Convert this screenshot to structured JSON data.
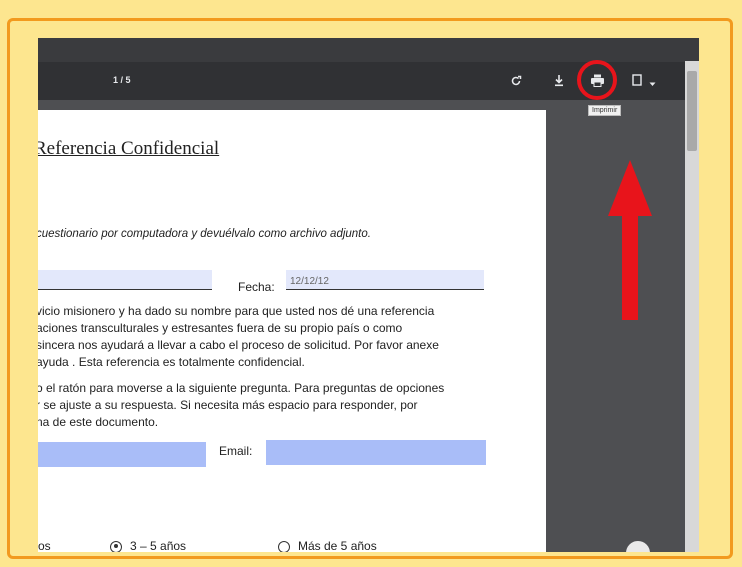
{
  "toolbar": {
    "page_count": "1 / 5",
    "tooltip": "Imprimir"
  },
  "icons": [
    "rotate-icon",
    "download-icon",
    "print-icon",
    "bookmark-icon",
    "chevron-down-icon"
  ],
  "colors": {
    "background": "#fde68f",
    "frame": "#f29a1e",
    "highlight": "#e8141b",
    "field": "#a9bdf8"
  },
  "document": {
    "title": "Referencia Confidencial",
    "instruction": "cuestionario por computadora y devuélvalo como archivo adjunto.",
    "fecha_label": "Fecha:",
    "fecha_value": "12/12/12",
    "paragraph1": [
      "vicio misionero y ha dado su nombre para que usted nos dé una referencia",
      "aciones transculturales y estresantes fuera de su propio país o como",
      "sincera nos ayudará a llevar a cabo el proceso de solicitud. Por favor anexe",
      "ayuda . Esta referencia es totalmente confidencial."
    ],
    "paragraph2": [
      "o el ratón para moverse a la siguiente pregunta. Para preguntas de opciones",
      "r se ajuste a su respuesta. Si necesita más espacio para responder, por",
      "na de este documento."
    ],
    "email_label": "Email:",
    "options": {
      "partial": "os",
      "option2": "3 – 5 años",
      "option3": "Más de 5 años"
    }
  }
}
